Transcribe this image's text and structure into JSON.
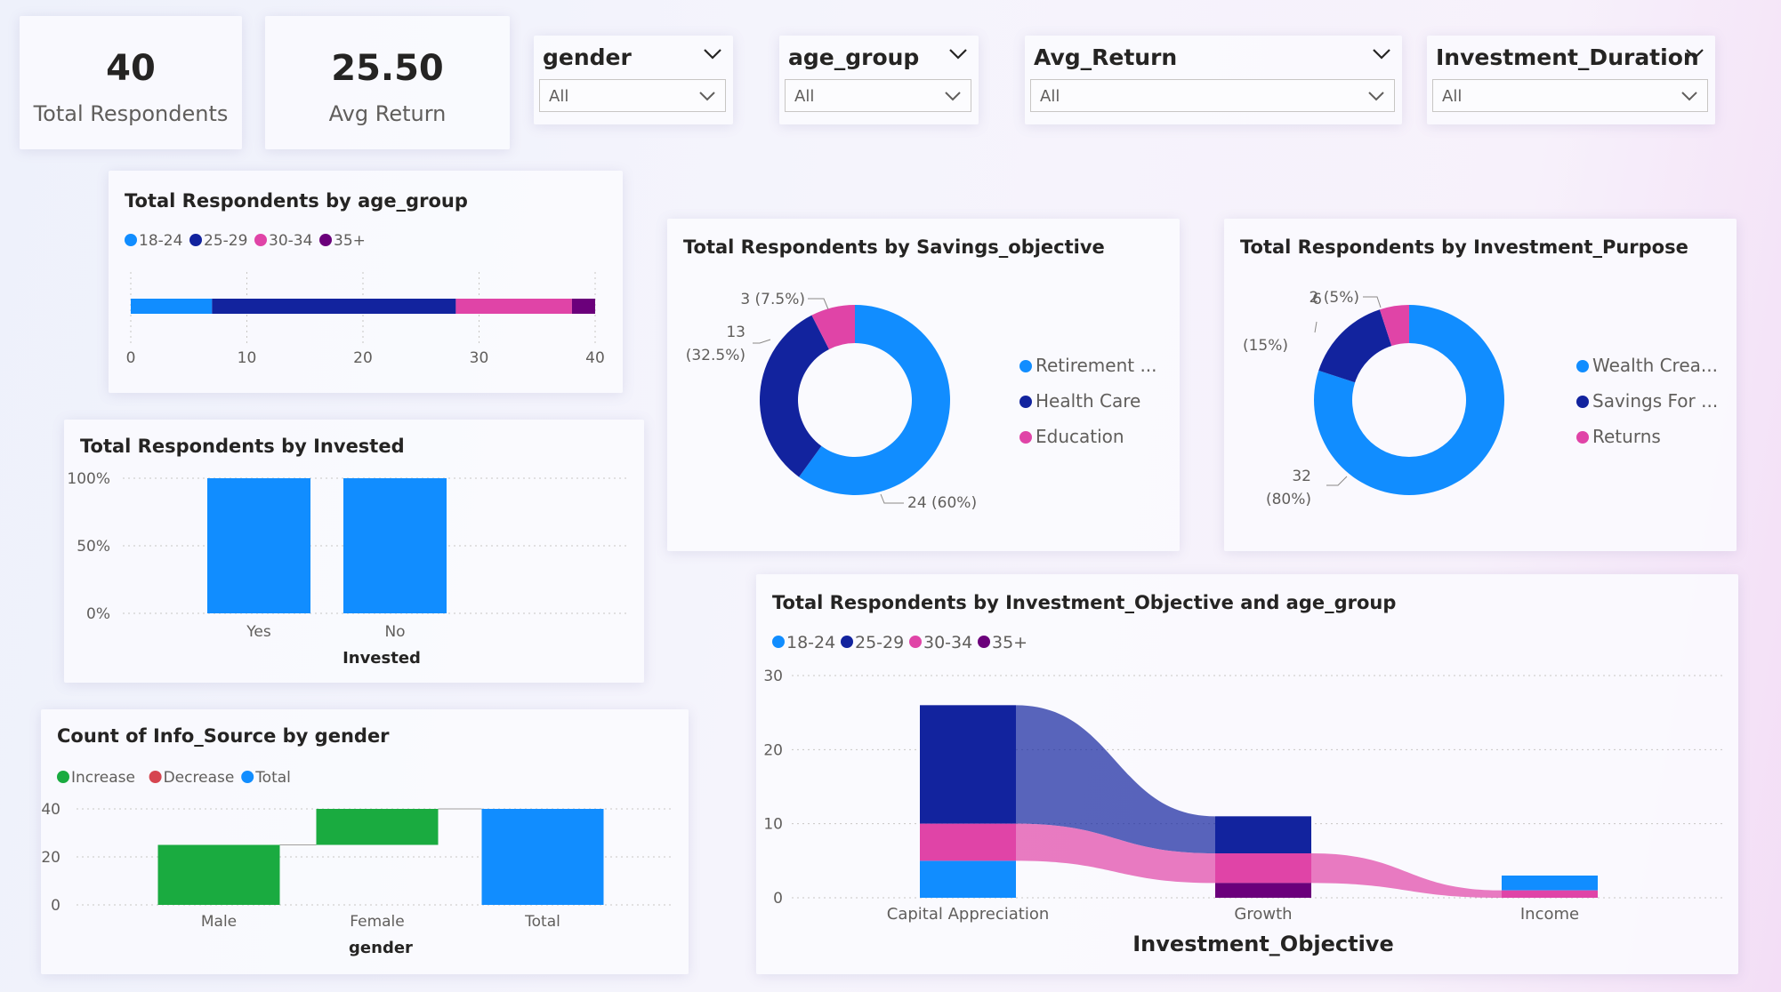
{
  "kpis": [
    {
      "value": "40",
      "label": "Total Respondents"
    },
    {
      "value": "25.50",
      "label": "Avg Return"
    }
  ],
  "slicers": [
    {
      "title": "gender",
      "value": "All"
    },
    {
      "title": "age_group",
      "value": "All"
    },
    {
      "title": "Avg_Return",
      "value": "All"
    },
    {
      "title": "Investment_Duration",
      "value": "All"
    }
  ],
  "colors": {
    "c18_24": "#118dff",
    "c25_29": "#12239e",
    "c30_34": "#e044a7",
    "c35plus": "#6b007b",
    "increase": "#1aab40",
    "decrease": "#d64550",
    "total": "#118dff"
  },
  "chart_data": [
    {
      "id": "age_bar",
      "type": "bar",
      "orientation": "horizontal-stacked",
      "title": "Total Respondents by age_group",
      "series": [
        {
          "name": "18-24",
          "values": [
            7
          ]
        },
        {
          "name": "25-29",
          "values": [
            21
          ]
        },
        {
          "name": "30-34",
          "values": [
            10
          ]
        },
        {
          "name": "35+",
          "values": [
            2
          ]
        }
      ],
      "xlim": [
        0,
        40
      ],
      "xticks": [
        "0",
        "10",
        "20",
        "30",
        "40"
      ],
      "legend": "top-left",
      "grid": true
    },
    {
      "id": "savings_donut",
      "type": "pie",
      "variant": "donut",
      "title": "Total Respondents by Savings_objective",
      "slices": [
        {
          "label": "Retirement ...",
          "value": 24,
          "data_label": "24 (60%)",
          "color": "#118dff"
        },
        {
          "label": "Health Care",
          "value": 13,
          "data_label": "13 (32.5%)",
          "color": "#12239e"
        },
        {
          "label": "Education",
          "value": 3,
          "data_label": "3 (7.5%)",
          "color": "#e044a7"
        }
      ],
      "legend": "right"
    },
    {
      "id": "purpose_donut",
      "type": "pie",
      "variant": "donut",
      "title": "Total Respondents by Investment_Purpose",
      "slices": [
        {
          "label": "Wealth Crea...",
          "value": 32,
          "data_label": "32 (80%)",
          "color": "#118dff"
        },
        {
          "label": "Savings For ...",
          "value": 6,
          "data_label": "6 (15%)",
          "color": "#12239e"
        },
        {
          "label": "Returns",
          "value": 2,
          "data_label": "2 (5%)",
          "color": "#e044a7"
        }
      ],
      "legend": "right"
    },
    {
      "id": "invested_bar",
      "type": "bar",
      "title": "Total Respondents by Invested",
      "categories": [
        "Yes",
        "No"
      ],
      "values": [
        100,
        100
      ],
      "xlabel": "Invested",
      "ylabel": "",
      "ylim": [
        0,
        100
      ],
      "yticks": [
        "0%",
        "50%",
        "100%"
      ],
      "grid": true
    },
    {
      "id": "info_waterfall",
      "type": "bar",
      "variant": "waterfall",
      "title": "Count of Info_Source by gender",
      "categories": [
        "Male",
        "Female",
        "Total"
      ],
      "steps": [
        {
          "category": "Male",
          "start": 0,
          "end": 25,
          "kind": "Increase"
        },
        {
          "category": "Female",
          "start": 25,
          "end": 40,
          "kind": "Increase"
        },
        {
          "category": "Total",
          "start": 0,
          "end": 40,
          "kind": "Total"
        }
      ],
      "legend_items": [
        "Increase",
        "Decrease",
        "Total"
      ],
      "xlabel": "gender",
      "ylim": [
        0,
        40
      ],
      "yticks": [
        "0",
        "20",
        "40"
      ],
      "grid": true
    },
    {
      "id": "objective_ribbon",
      "type": "bar",
      "variant": "ribbon-stacked",
      "title": "Total Respondents by Investment_Objective and age_group",
      "categories": [
        "Capital Appreciation",
        "Growth",
        "Income"
      ],
      "series": [
        {
          "name": "18-24",
          "values": [
            5,
            0,
            2
          ]
        },
        {
          "name": "25-29",
          "values": [
            16,
            5,
            0
          ]
        },
        {
          "name": "30-34",
          "values": [
            5,
            4,
            1
          ]
        },
        {
          "name": "35+",
          "values": [
            0,
            2,
            0
          ]
        }
      ],
      "xlabel": "Investment_Objective",
      "ylabel": "",
      "ylim": [
        0,
        30
      ],
      "yticks": [
        "0",
        "10",
        "20",
        "30"
      ],
      "legend": "top-left",
      "grid": true
    }
  ]
}
